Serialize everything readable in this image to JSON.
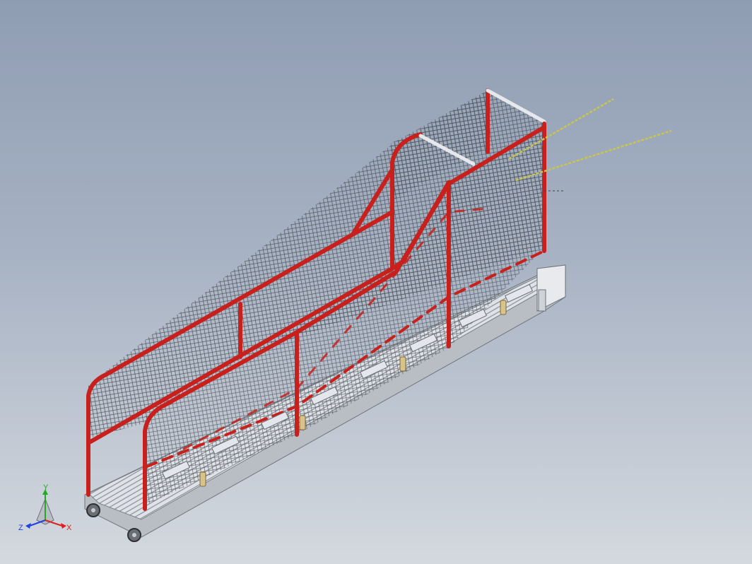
{
  "viewport": {
    "background_top": "#8f9db3",
    "background_bottom": "#d4d9df"
  },
  "model": {
    "frame_color": "#c8201c",
    "mesh_color": "#5a5f66",
    "deck_color": "#d7dbe0",
    "cable_color": "#c9c64a"
  },
  "triad": {
    "x_label": "X",
    "y_label": "Y",
    "z_label": "Z",
    "x_color": "#e02020",
    "y_color": "#22aa22",
    "z_color": "#2040e0"
  }
}
